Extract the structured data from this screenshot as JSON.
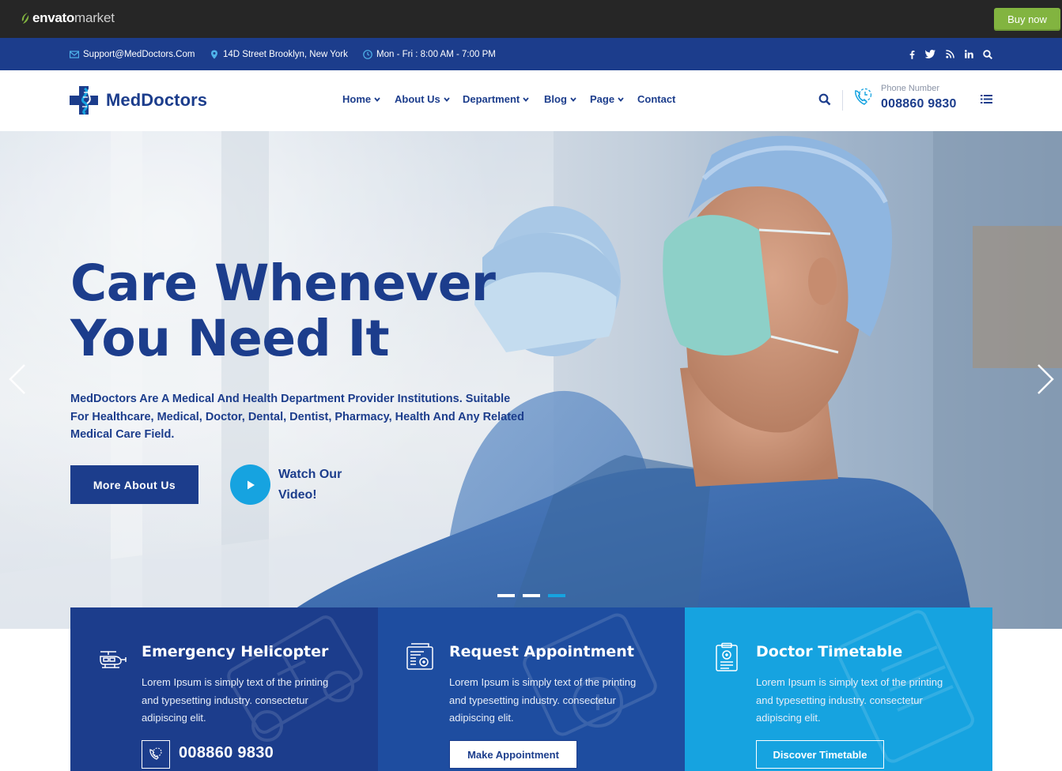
{
  "envato": {
    "logo_brand": "envato",
    "logo_market": "market",
    "buy_now": "Buy now"
  },
  "topbar": {
    "email": "Support@MedDoctors.Com",
    "address": "14D Street Brooklyn, New York",
    "hours": "Mon - Fri : 8:00 AM - 7:00 PM",
    "social": [
      {
        "icon": "facebook-icon",
        "glyph": "f"
      },
      {
        "icon": "twitter-icon",
        "glyph": "t"
      },
      {
        "icon": "rss-icon",
        "glyph": "rss"
      },
      {
        "icon": "linkedin-icon",
        "glyph": "in"
      },
      {
        "icon": "search-icon",
        "glyph": "search"
      }
    ]
  },
  "header": {
    "logo_text": "MedDoctors",
    "nav": [
      "Home",
      "About Us",
      "Department",
      "Blog",
      "Page",
      "Contact"
    ],
    "phone_label": "Phone Number",
    "phone_number": "008860 9830"
  },
  "hero": {
    "title_line1": "Care Whenever",
    "title_line2": "You Need It",
    "description": "MedDoctors Are A Medical And Health Department Provider Institutions. Suitable For Healthcare, Medical, Doctor, Dental, Dentist, Pharmacy, Health And Any Related Medical Care Field.",
    "button": "More About Us",
    "watch_line1": "Watch Our",
    "watch_line2": "Video!",
    "slides_total": 3,
    "active_slide": 3
  },
  "features": [
    {
      "icon": "helicopter-icon",
      "title": "Emergency Helicopter",
      "text": "Lorem Ipsum is simply text of the printing and typesetting industry. consectetur adipiscing elit.",
      "phone": "008860 9830"
    },
    {
      "icon": "appointment-icon",
      "title": "Request Appointment",
      "text": "Lorem Ipsum is simply text of the printing and typesetting industry. consectetur adipiscing elit.",
      "button": "Make Appointment"
    },
    {
      "icon": "timetable-icon",
      "title": "Doctor Timetable",
      "text": "Lorem Ipsum is simply text of the printing and typesetting industry. consectetur adipiscing elit.",
      "button": "Discover Timetable"
    }
  ],
  "colors": {
    "navy": "#1c3d8c",
    "blue": "#1e4da0",
    "cyan": "#16a3e0",
    "envato_green": "#82b440",
    "envato_dark": "#262626"
  }
}
